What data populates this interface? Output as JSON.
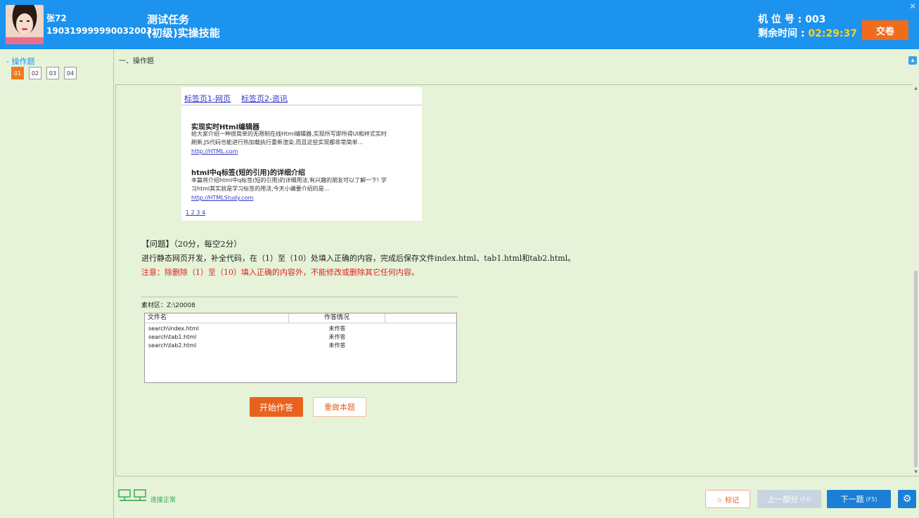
{
  "header": {
    "user_name": "张72",
    "user_id": "190319999990032003",
    "task_title": "测试任务",
    "task_subtitle": "(初级)实操技能",
    "seat_label": "机 位 号 : 003",
    "time_label": "剩余时间 : ",
    "time_value": "02:29:37",
    "submit_label": "交卷",
    "close_glyph": "✕"
  },
  "sidebar": {
    "section_label": "- 操作题",
    "questions": [
      "01",
      "02",
      "03",
      "04"
    ],
    "active_index": 0
  },
  "main": {
    "section_title": "一、操作题",
    "collapse_glyph": "▴",
    "preview": {
      "tabs": [
        "标签页1-网页",
        "标签页2-资讯"
      ],
      "articles": [
        {
          "title": "实现实时Html编辑器",
          "text_line1": "给大家介绍一种很简单的无限制在线Html编辑器,实现所写即所得UI和样式实时",
          "text_line2": "刷新,JS代码也能进行热加载执行重新渲染,而且这些实现都非常简单...",
          "link": "http://HTML.com"
        },
        {
          "title": "html中q标签(短的引用)的详细介绍",
          "text_line1": "本篇将介绍html中q标签(短的引用)的详细用法,有兴趣的朋友可以了解一下! 学",
          "text_line2": "习html其实就是学习标签的用法,今天小编要介绍的是...",
          "link": "http://HTMLStudy.com"
        }
      ],
      "pager": "1 2 3 4"
    },
    "question": {
      "head": "【问题】（20分，每空2分）",
      "body": "进行静态网页开发，补全代码，在（1）至（10）处填入正确的内容，完成后保存文件index.html、tab1.html和tab2.html。",
      "warning": "注意：除删除（1）至（10）填入正确的内容外，不能修改或删除其它任何内容。"
    },
    "material_label": "素材区：Z:\\20008",
    "file_table": {
      "columns": [
        "文件名",
        "作答情况"
      ],
      "rows": [
        [
          "search\\index.html",
          "未作答"
        ],
        [
          "search\\tab1.html",
          "未作答"
        ],
        [
          "search\\tab2.html",
          "未作答"
        ]
      ]
    },
    "start_label": "开始作答",
    "redo_label": "重做本题"
  },
  "footer": {
    "net_status": "连接正常",
    "mark_label": "☆ 标记",
    "prev_label": "上一部分",
    "prev_key": "(F4)",
    "next_label": "下一题",
    "next_key": "(F5)",
    "gear_glyph": "⚙"
  }
}
